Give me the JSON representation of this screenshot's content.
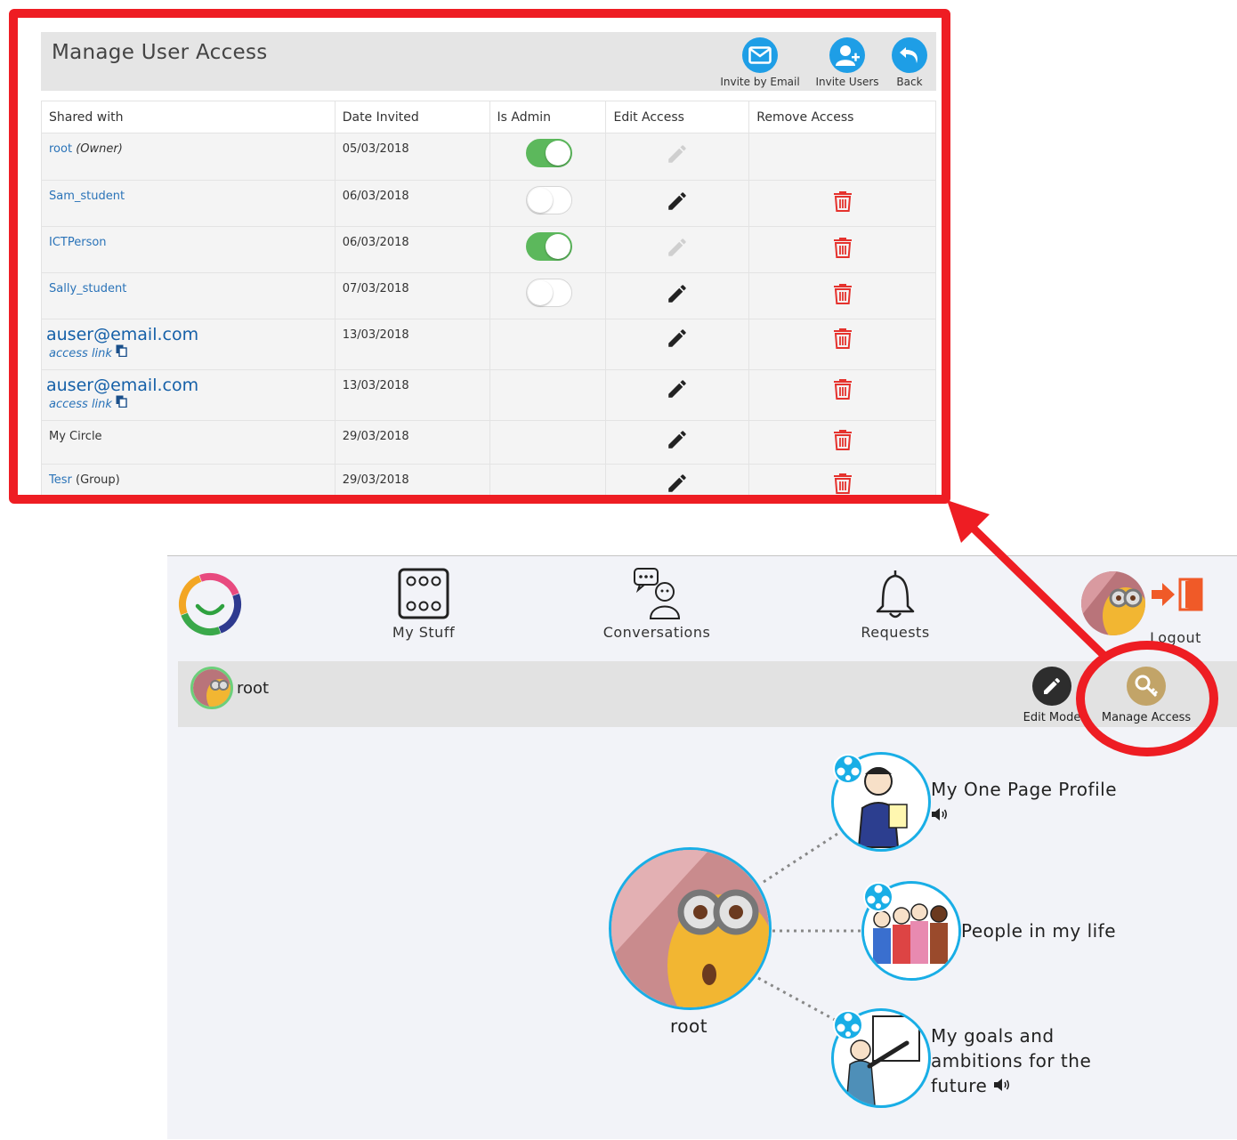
{
  "panel": {
    "title": "Manage User Access",
    "buttons": {
      "invite_email": "Invite by Email",
      "invite_users": "Invite Users",
      "back": "Back"
    },
    "columns": [
      "Shared with",
      "Date Invited",
      "Is Admin",
      "Edit Access",
      "Remove Access"
    ],
    "rows": [
      {
        "name": "root",
        "suffix": "(Owner)",
        "date": "05/03/2018",
        "admin": true
      },
      {
        "name": "Sam_student",
        "date": "06/03/2018",
        "admin": false
      },
      {
        "name": "ICTPerson",
        "date": "06/03/2018",
        "admin": true
      },
      {
        "name": "Sally_student",
        "date": "07/03/2018",
        "admin": false
      },
      {
        "name": "auser@email.com",
        "link": "access link",
        "date": "13/03/2018"
      },
      {
        "name": "auser@email.com",
        "link": "access link",
        "date": "13/03/2018"
      },
      {
        "name": "My Circle",
        "date": "29/03/2018"
      },
      {
        "name": "Tesr",
        "suffix": "(Group)",
        "date": "29/03/2018"
      }
    ]
  },
  "nav": {
    "my_stuff": "My Stuff",
    "conversations": "Conversations",
    "requests": "Requests",
    "logout": "Logout"
  },
  "userbar": {
    "username": "root",
    "edit_mode": "Edit Mode",
    "manage_access": "Manage Access"
  },
  "mindmap": {
    "center": "root",
    "node1": "My One Page Profile",
    "node2": "People in my life",
    "node3_line1": "My goals and",
    "node3_line2": "ambitions for the",
    "node3_line3": "future"
  },
  "colors": {
    "highlight": "#ee1d23",
    "accent_blue": "#1e9ee6",
    "toggle_on": "#5cb85c",
    "delete": "#e5322d"
  }
}
